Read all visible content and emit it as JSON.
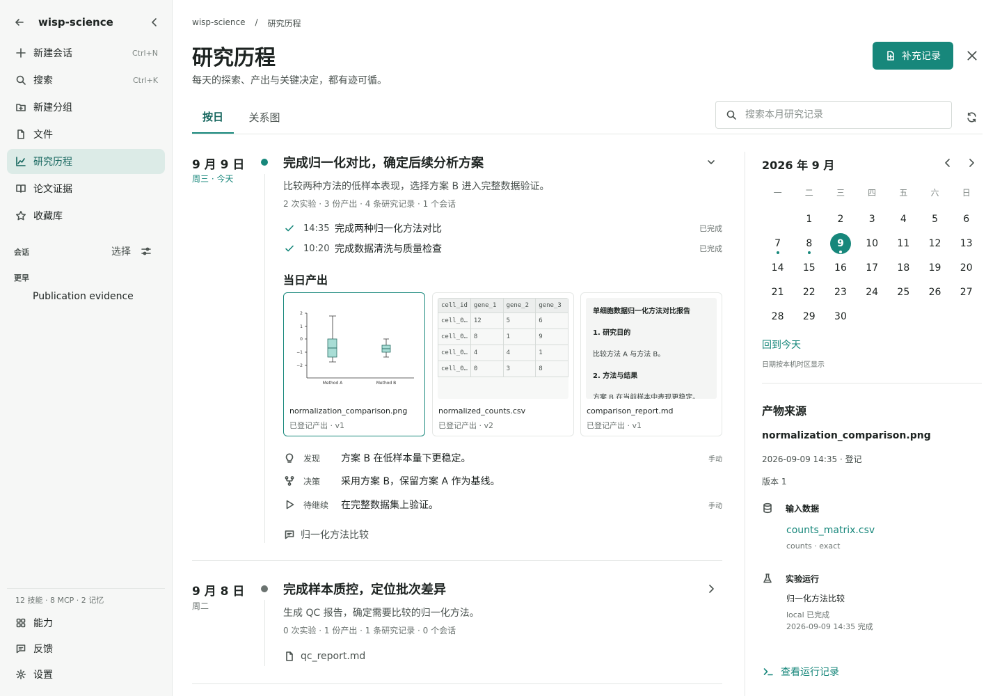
{
  "sidebar": {
    "workspace": "wisp-science",
    "items": [
      {
        "label": "新建会话",
        "kbd": "Ctrl+N"
      },
      {
        "label": "搜索",
        "kbd": "Ctrl+K"
      },
      {
        "label": "新建分组",
        "kbd": ""
      },
      {
        "label": "文件",
        "kbd": ""
      },
      {
        "label": "研究历程",
        "kbd": ""
      },
      {
        "label": "论文证据",
        "kbd": ""
      },
      {
        "label": "收藏库",
        "kbd": ""
      }
    ],
    "sessions_label": "会话",
    "select_label": "选择",
    "earlier_label": "更早",
    "earlier_items": [
      "Publication evidence"
    ],
    "stats": "12 技能 · 8 MCP · 2 记忆",
    "bottom": [
      {
        "label": "能力"
      },
      {
        "label": "反馈"
      },
      {
        "label": "设置"
      }
    ]
  },
  "header": {
    "breadcrumb": [
      "wisp-science",
      "/",
      "研究历程"
    ],
    "title": "研究历程",
    "subtitle": "每天的探索、产出与关键决定，都有迹可循。",
    "add_button": "补充记录",
    "tabs": [
      {
        "label": "按日"
      },
      {
        "label": "关系图"
      }
    ],
    "search_placeholder": "搜索本月研究记录"
  },
  "days": [
    {
      "date": "9 月 9 日",
      "weekday": "周三 · 今天",
      "title": "完成归一化对比，确定后续分析方案",
      "desc": "比较两种方法的低样本表现，选择方案 B 进入完整数据验证。",
      "meta": "2 次实验 · 3 份产出 · 4 条研究记录 · 1 个会话",
      "tasks": [
        {
          "time": "14:35",
          "text": "完成两种归一化方法对比",
          "status": "已完成"
        },
        {
          "time": "10:20",
          "text": "完成数据清洗与质量检查",
          "status": "已完成"
        }
      ],
      "outputs_label": "当日产出",
      "outputs": [
        {
          "name": "normalization_comparison.png",
          "status": "已登记产出 · v1"
        },
        {
          "name": "normalized_counts.csv",
          "status": "已登记产出 · v2"
        },
        {
          "name": "comparison_report.md",
          "status": "已登记产出 · v1"
        }
      ],
      "plot": {
        "yticks": [
          "2",
          "1",
          "0",
          "−1",
          "−2"
        ],
        "xlabels": [
          "Method A",
          "Method B"
        ]
      },
      "csv": {
        "header": [
          "cell_id",
          "gene_1",
          "gene_2",
          "gene_3"
        ],
        "rows": [
          [
            "cell_0…",
            "12",
            "5",
            "6"
          ],
          [
            "cell_0…",
            "8",
            "1",
            "9"
          ],
          [
            "cell_0…",
            "4",
            "4",
            "1"
          ],
          [
            "cell_0…",
            "0",
            "3",
            "8"
          ]
        ]
      },
      "md": {
        "h1": "单细胞数据归一化方法对比报告",
        "s1": "1. 研究目的",
        "p1": "比较方法 A 与方法 B。",
        "s2": "2. 方法与结果",
        "p2": "方案 B 在当前样本中表现更稳定。"
      },
      "notes": [
        {
          "kind": "发现",
          "text": "方案 B 在低样本量下更稳定。",
          "meta": "手动"
        },
        {
          "kind": "决策",
          "text": "采用方案 B，保留方案 A 作为基线。",
          "meta": ""
        },
        {
          "kind": "待继续",
          "text": "在完整数据集上验证。",
          "meta": "手动"
        }
      ],
      "session": "归一化方法比较"
    },
    {
      "date": "9 月 8 日",
      "weekday": "周二",
      "title": "完成样本质控，定位批次差异",
      "desc": "生成 QC 报告，确定需要比较的归一化方法。",
      "meta": "0 次实验 · 1 份产出 · 1 条研究记录 · 0 个会话",
      "file": "qc_report.md"
    }
  ],
  "calendar": {
    "title": "2026 年 9 月",
    "weekdays": [
      "一",
      "二",
      "三",
      "四",
      "五",
      "六",
      "日"
    ],
    "offset": 1,
    "days_in_month": 30,
    "today": 9,
    "marked": [
      7,
      8,
      9
    ],
    "back_today": "回到今天",
    "tz_note": "日期按本机时区显示"
  },
  "provenance": {
    "heading": "产物来源",
    "file": "normalization_comparison.png",
    "time": "2026-09-09 14:35 · 登记",
    "version": "版本 1",
    "input_label": "输入数据",
    "input_file": "counts_matrix.csv",
    "input_meta": "counts · exact",
    "run_label": "实验运行",
    "run_name": "归一化方法比较",
    "run_status": "local 已完成",
    "run_time": "2026-09-09 14:35 完成",
    "view_runs": "查看运行记录"
  },
  "colors": {
    "accent": "#17877b",
    "accent_bg": "#dcebe7",
    "today_dot": "#17877b",
    "past_dot": "#6b7370"
  }
}
